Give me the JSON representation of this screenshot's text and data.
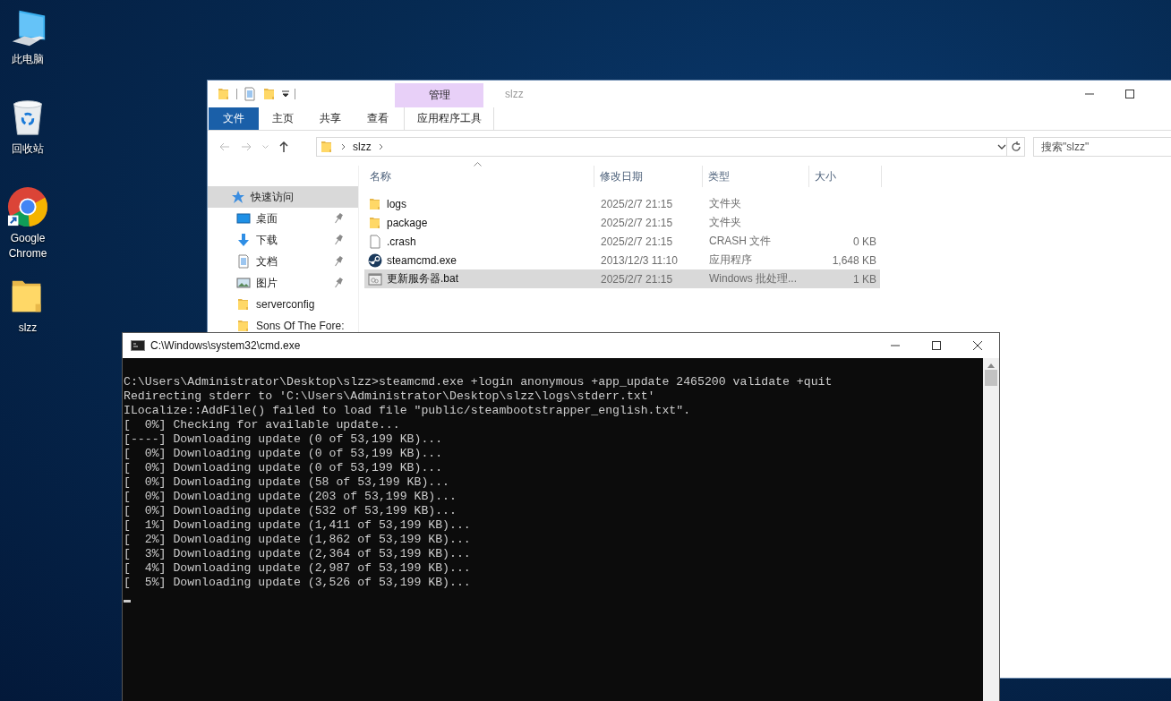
{
  "desktop": {
    "icons": [
      {
        "kind": "computer",
        "label": "此电脑"
      },
      {
        "kind": "recycle-bin",
        "label": "回收站"
      },
      {
        "kind": "chrome",
        "label": "Google Chrome"
      },
      {
        "kind": "folder",
        "label": "slzz"
      }
    ]
  },
  "explorer": {
    "title": "slzz",
    "contextual_tab": "管理",
    "ribbon_tabs": [
      {
        "kind": "file",
        "label": "文件"
      },
      {
        "kind": "tab",
        "label": "主页"
      },
      {
        "kind": "tab",
        "label": "共享"
      },
      {
        "kind": "tab",
        "label": "查看"
      },
      {
        "kind": "contextual",
        "label": "应用程序工具"
      }
    ],
    "address": {
      "path": [
        "slzz"
      ]
    },
    "search": {
      "placeholder": "搜索\"slzz\""
    },
    "nav": [
      {
        "kind": "star",
        "label": "快速访问",
        "selected": true,
        "pinned": false
      },
      {
        "kind": "desktop",
        "label": "桌面",
        "selected": false,
        "pinned": true
      },
      {
        "kind": "download",
        "label": "下载",
        "selected": false,
        "pinned": true
      },
      {
        "kind": "document",
        "label": "文档",
        "selected": false,
        "pinned": true
      },
      {
        "kind": "picture",
        "label": "图片",
        "selected": false,
        "pinned": true
      },
      {
        "kind": "folder",
        "label": "serverconfig",
        "selected": false,
        "pinned": false
      },
      {
        "kind": "folder",
        "label": "Sons Of The Fore:",
        "selected": false,
        "pinned": false
      }
    ],
    "columns": [
      {
        "label": "名称",
        "sorted": true
      },
      {
        "label": "修改日期",
        "sorted": false
      },
      {
        "label": "类型",
        "sorted": false
      },
      {
        "label": "大小",
        "sorted": false
      }
    ],
    "rows": [
      {
        "kind": "folder",
        "name": "logs",
        "date": "2025/2/7 21:15",
        "type": "文件夹",
        "size": "",
        "selected": false
      },
      {
        "kind": "folder",
        "name": "package",
        "date": "2025/2/7 21:15",
        "type": "文件夹",
        "size": "",
        "selected": false
      },
      {
        "kind": "file",
        "name": ".crash",
        "date": "2025/2/7 21:15",
        "type": "CRASH 文件",
        "size": "0 KB",
        "selected": false
      },
      {
        "kind": "steam",
        "name": "steamcmd.exe",
        "date": "2013/12/3 11:10",
        "type": "应用程序",
        "size": "1,648 KB",
        "selected": false
      },
      {
        "kind": "batch",
        "name": "更新服务器.bat",
        "date": "2025/2/7 21:15",
        "type": "Windows 批处理...",
        "size": "1 KB",
        "selected": true
      }
    ]
  },
  "console": {
    "title": "C:\\Windows\\system32\\cmd.exe",
    "cursor": true,
    "lines": [
      "C:\\Users\\Administrator\\Desktop\\slzz>steamcmd.exe +login anonymous +app_update 2465200 validate +quit",
      "Redirecting stderr to 'C:\\Users\\Administrator\\Desktop\\slzz\\logs\\stderr.txt'",
      "ILocalize::AddFile() failed to load file \"public/steambootstrapper_english.txt\".",
      "[  0%] Checking for available update...",
      "[----] Downloading update (0 of 53,199 KB)...",
      "[  0%] Downloading update (0 of 53,199 KB)...",
      "[  0%] Downloading update (0 of 53,199 KB)...",
      "[  0%] Downloading update (58 of 53,199 KB)...",
      "[  0%] Downloading update (203 of 53,199 KB)...",
      "[  0%] Downloading update (532 of 53,199 KB)...",
      "[  1%] Downloading update (1,411 of 53,199 KB)...",
      "[  2%] Downloading update (1,862 of 53,199 KB)...",
      "[  3%] Downloading update (2,364 of 53,199 KB)...",
      "[  4%] Downloading update (2,987 of 53,199 KB)...",
      "[  5%] Downloading update (3,526 of 53,199 KB)..."
    ]
  }
}
